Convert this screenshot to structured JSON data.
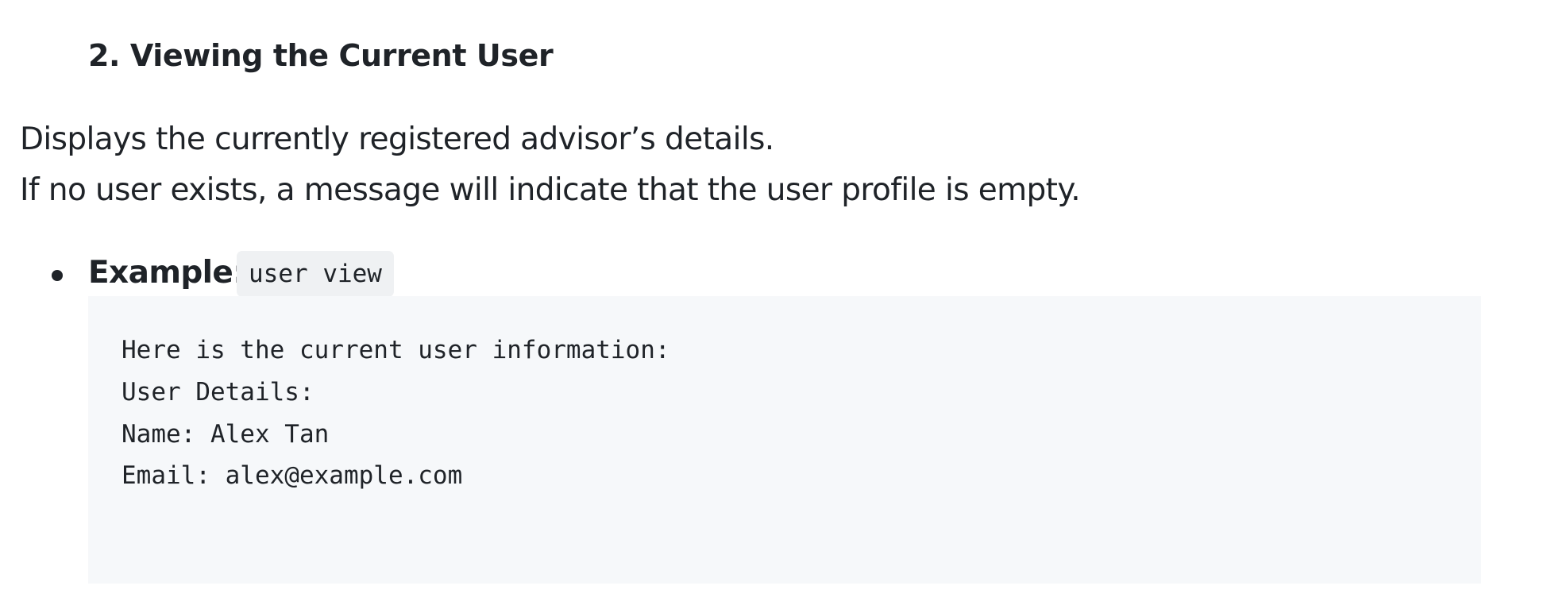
{
  "section": {
    "heading": "2. Viewing the Current User",
    "description_lines": [
      "Displays the currently registered advisor’s details.",
      "If no user exists, a message will indicate that the user profile is empty."
    ]
  },
  "example": {
    "label": "Example:",
    "command": "user view",
    "output_lines": [
      "Here is the current user information:",
      "User Details:",
      "Name: Alex Tan",
      "Email: alex@example.com"
    ]
  }
}
